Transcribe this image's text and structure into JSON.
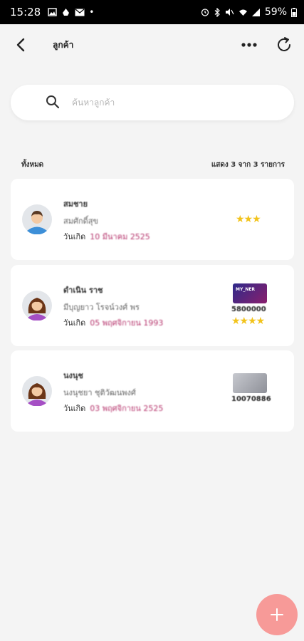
{
  "status_bar": {
    "time": "15:28",
    "battery": "59%",
    "left_icons": [
      "image-icon",
      "drive-icon",
      "mail-icon",
      "dot-icon"
    ],
    "right_icons": [
      "alarm-icon",
      "bluetooth-icon",
      "mute-icon",
      "wifi-icon",
      "signal-icon",
      "battery-icon"
    ]
  },
  "header": {
    "title": "ลูกค้า"
  },
  "search": {
    "placeholder": "ค้นหาลูกค้า"
  },
  "summary": {
    "all_label": "ทั้งหมด",
    "count_text": "แสดง 3 จาก 3 รายการ"
  },
  "customers": [
    {
      "name": "สมชาย",
      "subtitle": "สมศักดิ์สุข",
      "birthday_label": "วันเกิด",
      "birthday_value": "10 มีนาคม 2525",
      "avatar": "male-avatar-icon",
      "stars": 3,
      "has_member_card": false
    },
    {
      "name": "ดำเนิน ราช",
      "subtitle": "มีบุญยาว โรจน์วงศ์ พร",
      "birthday_label": "วันเกิด",
      "birthday_value": "05 พฤศจิกายน 1993",
      "avatar": "female-avatar-icon",
      "stars": 4,
      "has_member_card": true,
      "member_card_text": "MY_NER",
      "member_card_color": "#7a1b6e",
      "member_number": "5800000"
    },
    {
      "name": "นงนุช",
      "subtitle": "นงนุชยา ชุติวัฒนพงศ์",
      "birthday_label": "วันเกิด",
      "birthday_value": "03 พฤศจิกายน 2525",
      "avatar": "female-avatar-icon",
      "stars": 0,
      "has_member_card": true,
      "member_card_text": "",
      "member_card_color": "#a8abb3",
      "member_number": "10070886"
    }
  ],
  "colors": {
    "background": "#f4f4f4",
    "accent_fab": "#f79a98",
    "star": "#f2c31b",
    "birthday": "#b5336b"
  },
  "fab": {
    "icon": "plus-icon"
  }
}
